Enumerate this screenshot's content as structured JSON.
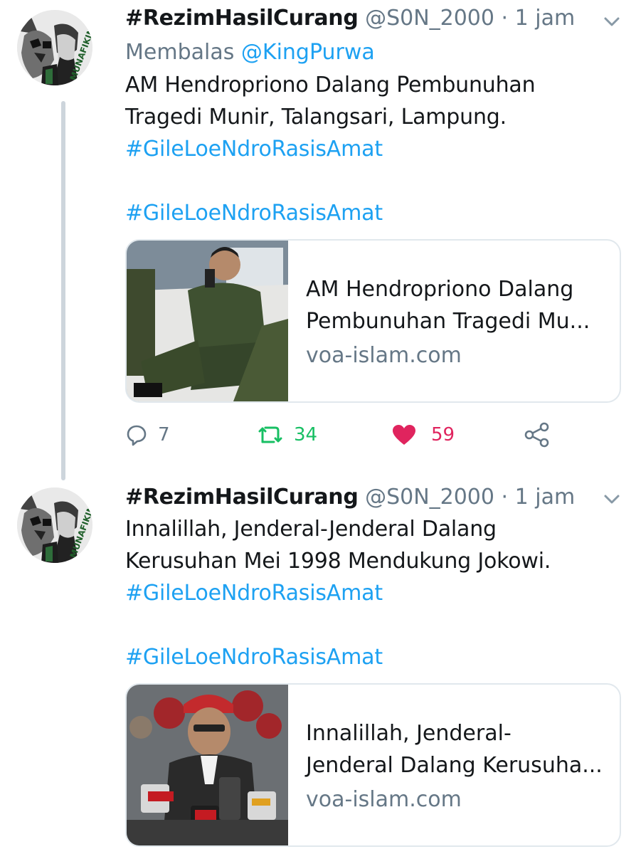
{
  "tweets": [
    {
      "display_name": "#RezimHasilCurang",
      "handle": "@S0N_2000",
      "separator": "·",
      "time": "1 jam",
      "reply_prefix": "Membalas",
      "reply_to": "@KingPurwa",
      "body_lines": [
        "AM Hendropriono Dalang Pembunuhan",
        "Tragedi Munir, Talangsari, Lampung."
      ],
      "hashtag_1": "#GileLoeNdroRasisAmat",
      "hashtag_2": "#GileLoeNdroRasisAmat",
      "card": {
        "title_lines": [
          "AM Hendropriono Dalang",
          "Pembunuhan Tragedi Mu..."
        ],
        "domain": "voa-islam.com"
      },
      "replies": "7",
      "retweets": "34",
      "likes": "59",
      "liked": true
    },
    {
      "display_name": "#RezimHasilCurang",
      "handle": "@S0N_2000",
      "separator": "·",
      "time": "1 jam",
      "body_lines": [
        "Innalillah, Jenderal-Jenderal Dalang",
        "Kerusuhan Mei 1998 Mendukung Jokowi."
      ],
      "hashtag_1": "#GileLoeNdroRasisAmat",
      "hashtag_2": "#GileLoeNdroRasisAmat",
      "card": {
        "title_lines": [
          "Innalillah, Jenderal-",
          "Jenderal Dalang Kerusuha..."
        ],
        "domain": "voa-islam.com"
      }
    }
  ],
  "avatar_text": "MUNAFIKIN",
  "colors": {
    "link": "#1da1f2",
    "muted": "#657786",
    "retweet": "#17bf63",
    "like": "#e0245e",
    "thread_line": "#cdd5dc",
    "card_border": "#e1e8ed"
  },
  "icons": [
    "chevron-down-icon",
    "reply-icon",
    "retweet-icon",
    "heart-icon",
    "share-icon"
  ]
}
